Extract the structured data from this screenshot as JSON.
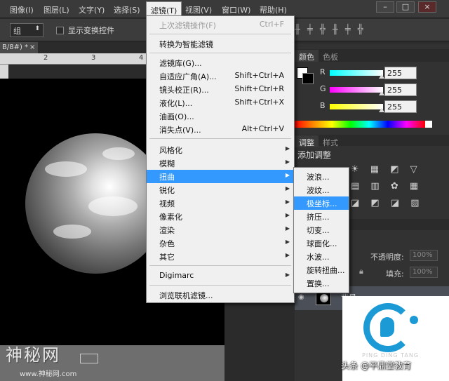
{
  "menubar": {
    "items": [
      "图像(I)",
      "图层(L)",
      "文字(Y)",
      "选择(S)",
      "滤镜(T)",
      "视图(V)",
      "窗口(W)",
      "帮助(H)"
    ],
    "active_index": 4
  },
  "window_controls": {
    "minimize": "–",
    "restore": "□",
    "close": "×"
  },
  "options_bar": {
    "group_select": "组",
    "show_transform_label": "显示变换控件"
  },
  "document": {
    "tab_label": "B/8#) *",
    "tab_close": "×",
    "ruler_ticks": [
      "2",
      "3",
      "4"
    ]
  },
  "filter_menu": {
    "items": [
      {
        "label": "上次滤镜操作(F)",
        "shortcut": "Ctrl+F",
        "disabled": true
      },
      {
        "label": "转换为智能滤镜"
      },
      {
        "label": "滤镜库(G)..."
      },
      {
        "label": "自适应广角(A)...",
        "shortcut": "Shift+Ctrl+A"
      },
      {
        "label": "镜头校正(R)...",
        "shortcut": "Shift+Ctrl+R"
      },
      {
        "label": "液化(L)...",
        "shortcut": "Shift+Ctrl+X"
      },
      {
        "label": "油画(O)..."
      },
      {
        "label": "消失点(V)...",
        "shortcut": "Alt+Ctrl+V"
      },
      {
        "label": "风格化",
        "submenu": true
      },
      {
        "label": "模糊",
        "submenu": true
      },
      {
        "label": "扭曲",
        "submenu": true,
        "highlighted": true
      },
      {
        "label": "锐化",
        "submenu": true
      },
      {
        "label": "视频",
        "submenu": true
      },
      {
        "label": "像素化",
        "submenu": true
      },
      {
        "label": "渲染",
        "submenu": true
      },
      {
        "label": "杂色",
        "submenu": true
      },
      {
        "label": "其它",
        "submenu": true
      },
      {
        "label": "Digimarc",
        "submenu": true
      },
      {
        "label": "浏览联机滤镜..."
      }
    ]
  },
  "distort_submenu": {
    "items": [
      "波浪...",
      "波纹...",
      "极坐标...",
      "挤压...",
      "切变...",
      "球面化...",
      "水波...",
      "旋转扭曲...",
      "置换..."
    ],
    "highlighted_index": 2
  },
  "color_panel": {
    "tabs": [
      "颜色",
      "色板"
    ],
    "channels": [
      {
        "label": "R",
        "value": "255"
      },
      {
        "label": "G",
        "value": "255"
      },
      {
        "label": "B",
        "value": "255"
      }
    ]
  },
  "adjustments_panel": {
    "tabs": [
      "调整",
      "样式"
    ],
    "title": "添加调整"
  },
  "layers_panel": {
    "opacity_label": "不透明度:",
    "opacity_value": "100%",
    "fill_label": "填充:",
    "fill_value": "100%",
    "layer_name": "背景"
  },
  "watermarks": {
    "site_cn": "神秘网",
    "site_url": "www.神秘网.com",
    "logo_sub": "PING DING TANG",
    "caption": "头条 @平鼎堂教育"
  }
}
